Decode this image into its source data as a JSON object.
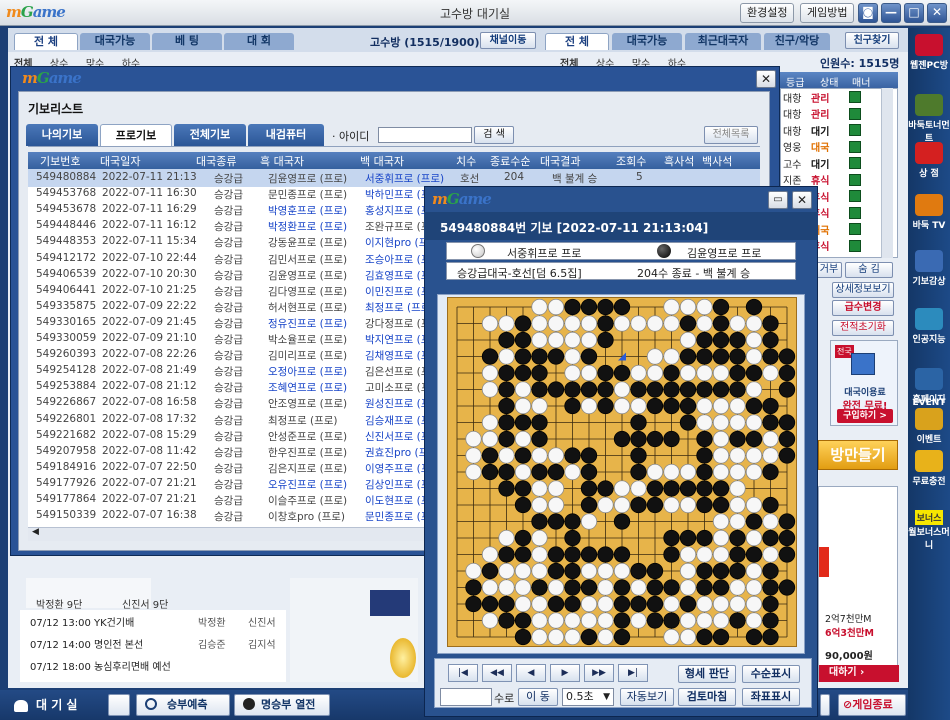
{
  "app": {
    "title": "고수방 대기실",
    "logo": [
      "m",
      "G",
      "ame"
    ],
    "top_buttons": [
      "환경설정",
      "게임방법"
    ]
  },
  "lobby": {
    "left_tabs": [
      "전 체",
      "대국가능",
      "베 팅",
      "대 회"
    ],
    "room_label": "고수방 (1515/1900)",
    "channel_button": "채널이동",
    "right_tabs": [
      "전 체",
      "대국가능",
      "최근대국자",
      "친구/악당"
    ],
    "friend_button": "친구찾기",
    "online_count": "인원수: 1515명",
    "sub_tabs_left": [
      "전체",
      "상수",
      "맞수",
      "하수"
    ],
    "sub_tabs_right": [
      "전체",
      "상수",
      "맞수",
      "하수"
    ],
    "user_list_headers": [
      "등급",
      "상태",
      "매너"
    ],
    "user_rows": [
      {
        "state": "대항",
        "grade": "관리",
        "color": "#c8102e"
      },
      {
        "state": "대항",
        "grade": "관리",
        "color": "#c8102e"
      },
      {
        "state": "대항",
        "grade": "대기",
        "color": "#111111"
      },
      {
        "state": "영웅",
        "grade": "대국",
        "color": "#e07000"
      },
      {
        "state": "고수",
        "grade": "대기",
        "color": "#111111"
      },
      {
        "state": "지존",
        "grade": "휴식",
        "color": "#c8102e"
      },
      {
        "state": "",
        "grade": "휴식",
        "color": "#c8102e"
      },
      {
        "state": "",
        "grade": "휴식",
        "color": "#c8102e"
      },
      {
        "state": "",
        "grade": "대국",
        "color": "#e07000"
      },
      {
        "state": "",
        "grade": "휴식",
        "color": "#c8102e"
      }
    ],
    "side_buttons": [
      "거부",
      "숨 김",
      "상세정보보기",
      "급수변경",
      "전적초기화"
    ],
    "room_make": "방만들기",
    "news": [
      {
        "date": "07/12 13:00",
        "title": "YK건기배",
        "p1": "박정환",
        "p2": "신진서"
      },
      {
        "date": "07/12 14:00",
        "title": "명인전 본선",
        "p1": "김승준",
        "p2": "김지석"
      },
      {
        "date": "07/12 18:00",
        "title": "농심후리면배 예선",
        "p1": "",
        "p2": ""
      }
    ],
    "players": [
      "박정환 9단",
      "신진서 9단"
    ],
    "ad_amount_1": "2억7천만M",
    "ad_amount_2": "6억3천만M",
    "ad_price": "90,000원",
    "ad_cta": "대하기",
    "promo": [
      "대국이용료",
      "완전 무료!",
      "구입하기 >"
    ],
    "promo_badge": "전국"
  },
  "sidebar": [
    {
      "label": "웹젠PC방",
      "icon": "webzen-icon",
      "color": "#c8102e"
    },
    {
      "label": "바둑토너먼트",
      "icon": "tournament-icon",
      "color": "#4e7a2c"
    },
    {
      "label": "상 점",
      "icon": "shop-icon",
      "color": "#d42020"
    },
    {
      "label": "바둑 TV",
      "icon": "tv-icon",
      "color": "#e07a10"
    },
    {
      "label": "기보감상",
      "icon": "magnifier-icon",
      "color": "#3a6ab3"
    },
    {
      "label": "인공지능",
      "icon": "ai-icon",
      "color": "#2c8bbd"
    },
    {
      "label": "홈페이지",
      "icon": "home-icon",
      "color": "#2b64a5"
    },
    {
      "label": "이벤트",
      "icon": "event-icon",
      "color": "#d9a21c"
    },
    {
      "label": "무료충전",
      "icon": "coin-icon",
      "color": "#e8b21a"
    },
    {
      "label": "월보너스머니",
      "icon": "bonus-icon",
      "color": "#f0d000"
    }
  ],
  "sidebar_event": "EVENT",
  "sidebar_bonus": "보너스",
  "bottom": {
    "waiting": "대 기 실",
    "prediction": "승부예측",
    "famous": "명승부 열전",
    "exit": "게임종료"
  },
  "kibo_window": {
    "title": "기보리스트",
    "tabs": [
      "나의기보",
      "프로기보",
      "전체기보",
      "내검퓨터"
    ],
    "id_label": "· 아이디",
    "id_value": "",
    "search": "검 색",
    "all_list": "전체목록",
    "headers": [
      "기보번호",
      "대국일자",
      "대국종류",
      "흑 대국자",
      "백 대국자",
      "치수",
      "종료수순",
      "대국결과",
      "조회수",
      "흑사석",
      "백사석"
    ],
    "rows": [
      [
        "549480884",
        "2022-07-11 21:13",
        "승강급",
        "김윤영프로 (프로)",
        "서중휘프로 (프로)",
        "호선",
        "204",
        "백 불계 승",
        "5"
      ],
      [
        "549453768",
        "2022-07-11 16:30",
        "승강급",
        "문민종프로 (프로)",
        "박하민프로 (프로)",
        "",
        "",
        "",
        ""
      ],
      [
        "549453678",
        "2022-07-11 16:29",
        "승강급",
        "박영훈프로 (프로)",
        "홍성지프로 (프로)",
        "",
        "",
        "",
        ""
      ],
      [
        "549448446",
        "2022-07-11 16:12",
        "승강급",
        "박정환프로 (프로)",
        "조완규프로 (프로)",
        "",
        "",
        "",
        ""
      ],
      [
        "549448353",
        "2022-07-11 15:34",
        "승강급",
        "강동윤프로 (프로)",
        "이지현pro (프로)",
        "",
        "",
        "",
        ""
      ],
      [
        "549412172",
        "2022-07-10 22:44",
        "승강급",
        "김민서프로 (프로)",
        "조승아프로 (프로)",
        "",
        "",
        "",
        ""
      ],
      [
        "549406539",
        "2022-07-10 20:30",
        "승강급",
        "김윤영프로 (프로)",
        "김효영프로 (프로)",
        "",
        "",
        "",
        ""
      ],
      [
        "549406441",
        "2022-07-10 21:25",
        "승강급",
        "김다영프로 (프로)",
        "이민진프로 (프로)",
        "",
        "",
        "",
        ""
      ],
      [
        "549335875",
        "2022-07-09 22:22",
        "승강급",
        "허서현프로 (프로)",
        "최정프로 (프로)",
        "",
        "",
        "",
        ""
      ],
      [
        "549330165",
        "2022-07-09 21:45",
        "승강급",
        "정유진프로 (프로)",
        "강다정프로 (프로)",
        "",
        "",
        "",
        ""
      ],
      [
        "549330059",
        "2022-07-09 21:10",
        "승강급",
        "박소율프로 (프로)",
        "박지연프로 (프로)",
        "",
        "",
        "",
        ""
      ],
      [
        "549260393",
        "2022-07-08 22:26",
        "승강급",
        "김미리프로 (프로)",
        "김채영프로 (프로)",
        "",
        "",
        "",
        ""
      ],
      [
        "549254128",
        "2022-07-08 21:49",
        "승강급",
        "오정아프로 (프로)",
        "김은선프로 (프로)",
        "",
        "",
        "",
        ""
      ],
      [
        "549253884",
        "2022-07-08 21:12",
        "승강급",
        "조혜연프로 (프로)",
        "고미소프로 (프로)",
        "",
        "",
        "",
        ""
      ],
      [
        "549226867",
        "2022-07-08 16:58",
        "승강급",
        "안조영프로 (프로)",
        "원성진프로 (프로)",
        "",
        "",
        "",
        ""
      ],
      [
        "549226801",
        "2022-07-08 17:32",
        "승강급",
        "최정프로 (프로)",
        "김승재프로 (프로)",
        "",
        "",
        "",
        ""
      ],
      [
        "549221682",
        "2022-07-08 15:29",
        "승강급",
        "안성준프로 (프로)",
        "신진서프로 (프로)",
        "",
        "",
        "",
        ""
      ],
      [
        "549207958",
        "2022-07-08 11:42",
        "승강급",
        "한우진프로 (프로)",
        "권효진pro (프로)",
        "",
        "",
        "",
        ""
      ],
      [
        "549184916",
        "2022-07-07 22:50",
        "승강급",
        "김은지프로 (프로)",
        "이영주프로 (프로)",
        "",
        "",
        "",
        ""
      ],
      [
        "549177926",
        "2022-07-07 21:21",
        "승강급",
        "오유진프로 (프로)",
        "김상인프로 (프로)",
        "",
        "",
        "",
        ""
      ],
      [
        "549177864",
        "2022-07-07 21:21",
        "승강급",
        "이슬주프로 (프로)",
        "이도현프로 (프로)",
        "",
        "",
        "",
        ""
      ],
      [
        "549150339",
        "2022-07-07 16:38",
        "승강급",
        "이창호pro (프로)",
        "문민종프로 (프로)",
        "",
        "",
        "",
        ""
      ]
    ],
    "black_blue_rows": [
      2,
      3,
      9,
      12,
      13,
      19
    ],
    "white_blue_rows": [
      0,
      1,
      2,
      4,
      5,
      6,
      7,
      8,
      10,
      11,
      14,
      15,
      16,
      17,
      18,
      19,
      20,
      21
    ]
  },
  "game_window": {
    "title": "549480884번 기보 [2022-07-11 21:13:04]",
    "white_player": "서중휘프로 프로",
    "black_player": "김윤영프로 프로",
    "game_info": "승강급대국-호선[덤 6.5집]",
    "result": "204수 종료 - 백 불계 승",
    "buttons": [
      "형세 판단",
      "수순표시",
      "검토마침",
      "좌표표시",
      "이 동",
      "자동보기"
    ],
    "move_suffix": "수로",
    "move_value": "",
    "speed": "0.5초",
    "nav": [
      "|◀",
      "◀◀",
      "◀",
      "▶",
      "▶▶",
      "▶|"
    ],
    "board_rows": [
      ".....WWBBBB..WWWB.B..",
      "..WWBWWWWBWWWWBWBWWB.",
      "...BBWWWWB....WBBBWB.",
      "..BWBBBWB...WWBBBBWBB",
      "..WBBB.WWBBWWBWWWBBWB",
      "..WBWBBBBBWBBBBBBBW.B",
      "...BWW.BWBWWBBBWWWBB.",
      "..WBBB.....B..BWWWWBB",
      ".WWBWB....BBBB.BWBBWB",
      ".WBWBWWBB..B...BWWWWB",
      ".WBBWBBWB..BWWWBWWWB.",
      "...BBWW.BBWWBBBBBW...",
      "....BWW.BWWBBWWBBWWB.",
      ".....BBBW.B.....WWBWB",
      "...WBW.B.....BBBWBWBB",
      "..WBBWBBBBB..BWWWBBWB",
      ".WBWWWBBWWWBB.WBBBWB.",
      ".BWWWBWBBWBWBBWBBWWBB",
      ".BBBWWBBWWBBBWBWWWWB.",
      "..WBBWWWWWBWBBWWWBWB.",
      "....BWWWBWB..WWBB.BB."
    ],
    "last_move": [
      10,
      3
    ]
  }
}
